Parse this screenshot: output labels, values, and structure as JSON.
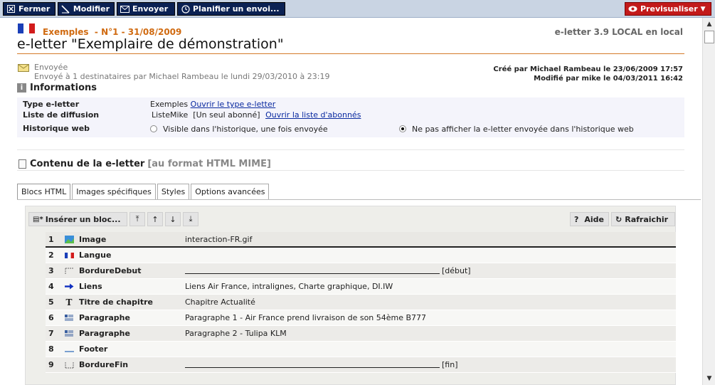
{
  "toolbar": {
    "close": "Fermer",
    "edit": "Modifier",
    "send": "Envoyer",
    "schedule": "Planifier un envoi...",
    "preview": "Previsualiser"
  },
  "header": {
    "breadcrumb": "Exemples  - N°1 - 31/08/2009",
    "version": "e-letter 3.9 LOCAL en local",
    "title": "e-letter \"Exemplaire de démonstration\""
  },
  "status": {
    "label": "Envoyée",
    "text": "Envoyé à 1 destinataires par Michael Rambeau le lundi 29/03/2010 à 23:19",
    "created": "Créé par Michael Rambeau le 23/06/2009 17:57",
    "modified": "Modifié par mike le 04/03/2011 16:42"
  },
  "info": {
    "heading": "Informations",
    "type_label": "Type e-letter",
    "type_value": "Exemples",
    "type_link": "Ouvrir le type e-letter",
    "list_label": "Liste de diffusion",
    "list_value": "ListeMike  [Un seul abonné]",
    "list_link": "Ouvrir la liste d'abonnés",
    "history_label": "Historique web",
    "history_opt1": "Visible dans l'historique, une fois envoyée",
    "history_opt2": "Ne pas afficher la e-letter envoyée dans l'historique web",
    "history_selected": 2
  },
  "content": {
    "heading": "Contenu de la e-letter",
    "format": "[au format HTML MIME]",
    "tabs": [
      "Blocs HTML",
      "Images spécifiques",
      "Styles",
      "Options avancées"
    ],
    "insert_label": "Insérer un bloc...",
    "help_label": "Aide",
    "refresh_label": "Rafraichir"
  },
  "blocks": [
    {
      "num": "1",
      "icon": "image-icon",
      "name": "Image",
      "value": "interaction-FR.gif"
    },
    {
      "num": "2",
      "icon": "flag-icon",
      "name": "Langue",
      "value": ""
    },
    {
      "num": "3",
      "icon": "border-start-icon",
      "name": "BordureDebut",
      "value": "[début]"
    },
    {
      "num": "4",
      "icon": "arrow-icon",
      "name": "Liens",
      "value": "Liens Air France, intralignes, Charte graphique, DI.IW"
    },
    {
      "num": "5",
      "icon": "title-icon",
      "name": "Titre de chapitre",
      "value": "Chapitre Actualité"
    },
    {
      "num": "6",
      "icon": "paragraph-icon",
      "name": "Paragraphe",
      "value": "Paragraphe 1 - Air France prend livraison de son 54ème B777"
    },
    {
      "num": "7",
      "icon": "paragraph-icon",
      "name": "Paragraphe",
      "value": "Paragraphe 2 - Tulipa KLM"
    },
    {
      "num": "8",
      "icon": "footer-icon",
      "name": "Footer",
      "value": ""
    },
    {
      "num": "9",
      "icon": "border-end-icon",
      "name": "BordureFin",
      "value": "[fin]"
    }
  ],
  "colors": {
    "toolbar_btn": "#0b2153",
    "preview_btn": "#c21a1a",
    "breadcrumb": "#d06a10",
    "link": "#0a2aa0"
  }
}
